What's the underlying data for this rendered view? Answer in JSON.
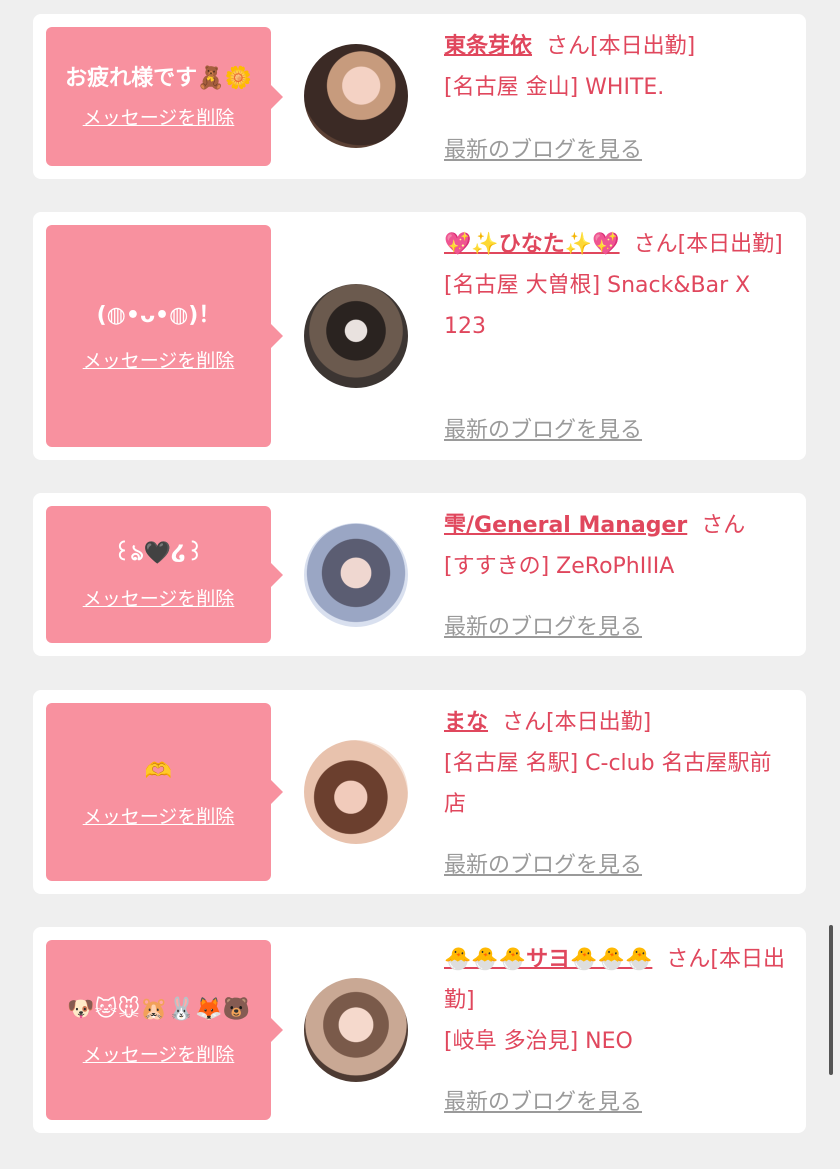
{
  "delete_label": "メッセージを削除",
  "blog_label": "最新のブログを見る",
  "san_label": "さん",
  "colors": {
    "bubble": "#f8919f",
    "name": "#e0475d",
    "blog": "#9a9a9a",
    "background": "#efefef"
  },
  "items": [
    {
      "message": "お疲れ様です🧸🌼",
      "name": "東条芽依",
      "status": "[本日出勤]",
      "shop": "[名古屋 金山] WHITE."
    },
    {
      "message": "(◍•ᴗ•◍)！",
      "name": "💖✨ひなた✨💖",
      "status": "[本日出勤]",
      "shop": "[名古屋 大曽根] Snack&Bar X 123"
    },
    {
      "message": "꒰ঌ🖤໒꒱",
      "name": "雫/General Manager",
      "status": "",
      "shop": "[すすきの] ZeRoPhIIIA"
    },
    {
      "message": "🫶",
      "name": "まな",
      "status": "[本日出勤]",
      "shop": "[名古屋 名駅] C-club 名古屋駅前店"
    },
    {
      "message": "🐶🐱🐭🐹🐰🦊🐻",
      "name": "🐣🐣🐣サヨ🐣🐣🐣",
      "status": "[本日出勤]",
      "shop": "[岐阜 多治見] NEO"
    }
  ]
}
